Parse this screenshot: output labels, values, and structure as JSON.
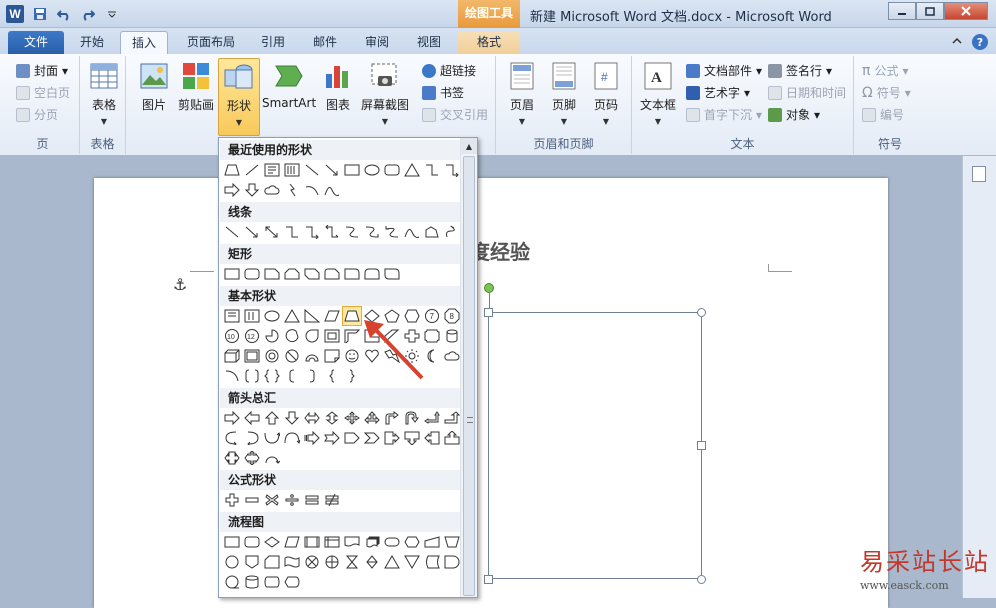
{
  "app": {
    "logo_letter": "W",
    "title": "新建 Microsoft Word 文档.docx - Microsoft Word",
    "context_tab_group": "绘图工具"
  },
  "tabs": [
    {
      "label": "文件"
    },
    {
      "label": "开始"
    },
    {
      "label": "插入"
    },
    {
      "label": "页面布局"
    },
    {
      "label": "引用"
    },
    {
      "label": "邮件"
    },
    {
      "label": "审阅"
    },
    {
      "label": "视图"
    },
    {
      "label": "格式"
    }
  ],
  "ribbon": {
    "groups": {
      "pages": "页",
      "tables": "表格",
      "header_footer": "页眉和页脚",
      "text": "文本",
      "symbols": "符号"
    },
    "pages": {
      "cover": "封面",
      "blank": "空白页",
      "break": "分页"
    },
    "table": "表格",
    "picture": "图片",
    "clipart": "剪贴画",
    "shapes": "形状",
    "smartart": "SmartArt",
    "chart": "图表",
    "screenshot": "屏幕截图",
    "links": {
      "hyperlink": "超链接",
      "bookmark": "书签",
      "crossref": "交叉引用"
    },
    "header": "页眉",
    "footer": "页脚",
    "page_number": "页码",
    "textbox": "文本框",
    "quickparts": "文档部件",
    "wordart": "艺术字",
    "dropcap": "首字下沉",
    "signature": "签名行",
    "datetime": "日期和时间",
    "object": "对象",
    "equation": "公式",
    "symbol": "符号",
    "numbering": "编号"
  },
  "gallery": {
    "sections": [
      "最近使用的形状",
      "线条",
      "矩形",
      "基本形状",
      "箭头总汇",
      "公式形状",
      "流程图"
    ]
  },
  "document": {
    "heading_visible": "度经验"
  },
  "watermark": {
    "line1": "易采站长站",
    "line2": "www.easck.com"
  }
}
